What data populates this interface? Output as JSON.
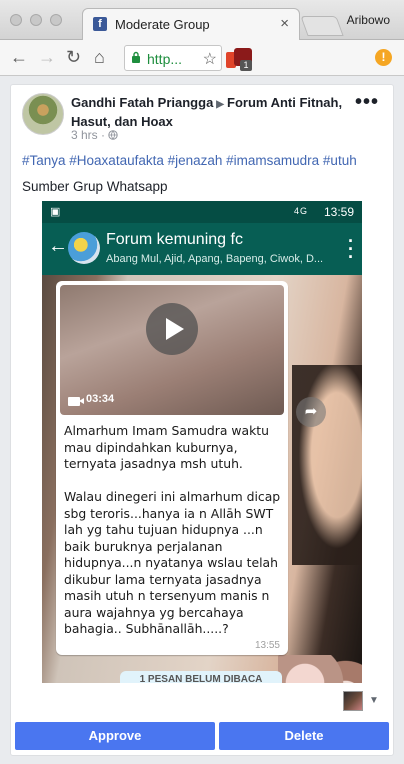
{
  "browser": {
    "tab_title": "Moderate Group",
    "tab_close": "×",
    "profile_name": "Aribowo",
    "url": "http...",
    "ext_badge": "1"
  },
  "post": {
    "author": "Gandhi Fatah Priangga",
    "group": "Forum Anti Fitnah, Hasut, dan Hoax",
    "time": "3 hrs",
    "privacy_icon": "globe-icon",
    "hashtags": "#Tanya #Hoaxataufakta #jenazah #imamsamudra #utuh",
    "text": "Sumber Grup Whatsapp"
  },
  "whatsapp": {
    "status_time": "13:59",
    "status_network": "4G",
    "group_name": "Forum kemuning fc",
    "members": "Abang Mul, Ajid, Apang, Bapeng, Ciwok, D...",
    "video_duration": "03:34",
    "message": "Almarhum Imam Samudra waktu mau dipindahkan kuburnya, ternyata jasadnya msh utuh.\n\nWalau dinegeri ini almarhum dicap sbg teroris...hanya ia n Allāh  SWT lah yg tahu tujuan hidupnya ...n baik buruknya perjalanan hidupnya...n nyatanya wslau telah dikubur lama ternyata jasadnya masih utuh n tersenyum manis n aura wajahnya yg bercahaya  bahagia.. Subhānallāh.....?",
    "message_time": "13:55",
    "unread_banner": "1 PESAN BELUM DIBACA"
  },
  "actions": {
    "approve": "Approve",
    "delete": "Delete"
  },
  "colors": {
    "facebook_blue": "#3b5998",
    "link_blue": "#4267b2",
    "button_blue": "#4a76f0",
    "whatsapp_header": "#075e54"
  }
}
